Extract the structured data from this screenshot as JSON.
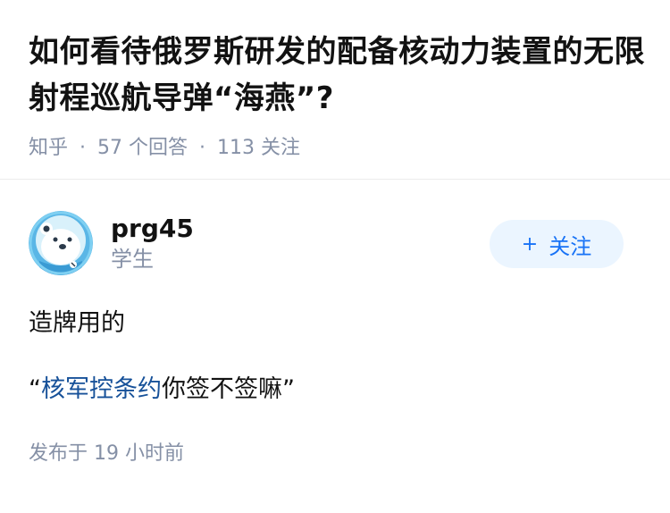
{
  "question": {
    "title": "如何看待俄罗斯研发的配备核动力装置的无限射程巡航导弹“海燕”?",
    "source": "知乎",
    "answer_count": "57 个回答",
    "follower_count": "113 关注"
  },
  "answer": {
    "author": {
      "name": "prg45",
      "headline": "学生",
      "avatar_icon": "polar-bear-astronaut-avatar"
    },
    "follow_button": {
      "icon": "plus-icon",
      "label": "关注"
    },
    "content": {
      "line1": "造牌用的",
      "quote_open": "“",
      "link_text": "核军控条约",
      "line2_rest": "你签不签嘛”"
    },
    "published": "发布于 19 小时前"
  },
  "colors": {
    "accent": "#1772f6",
    "link": "#175199",
    "meta_gray": "#8590a6",
    "button_bg": "#ebf5ff"
  }
}
